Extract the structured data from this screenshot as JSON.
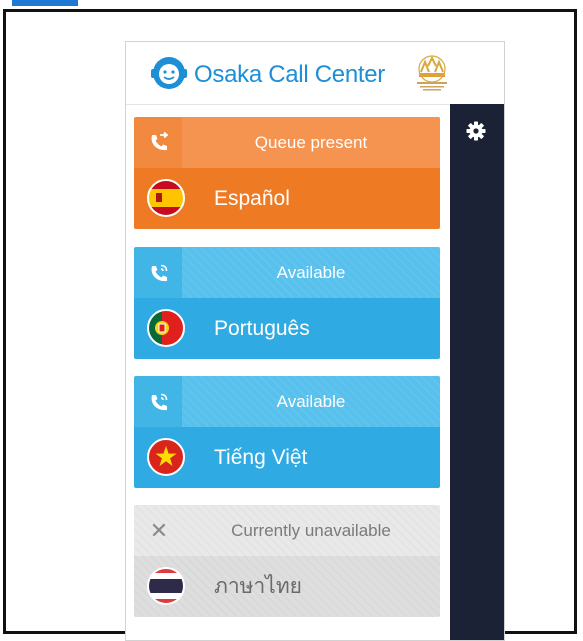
{
  "brand": {
    "name": "Osaka Call Center",
    "logo_icon": "smiling-face-headset-icon",
    "partner_logo_icon": "osaka-city-emblem-icon",
    "color": "#1d8fd6"
  },
  "settings": {
    "icon": "gear-icon",
    "panel_color": "#1b2236"
  },
  "languages": [
    {
      "status": "Queue present",
      "status_icon": "phone-forward-icon",
      "name": "Español",
      "flag_icon": "spain-flag-icon",
      "color": "#ef7a24"
    },
    {
      "status": "Available",
      "status_icon": "phone-ringing-icon",
      "name": "Português",
      "flag_icon": "portugal-flag-icon",
      "color": "#30aae2"
    },
    {
      "status": "Available",
      "status_icon": "phone-ringing-icon",
      "name": "Tiếng Việt",
      "flag_icon": "vietnam-flag-icon",
      "color": "#30aae2"
    },
    {
      "status": "Currently unavailable",
      "status_icon": "close-icon",
      "name": "ภาษาไทย",
      "flag_icon": "thailand-flag-icon",
      "color": "#dedede"
    }
  ]
}
